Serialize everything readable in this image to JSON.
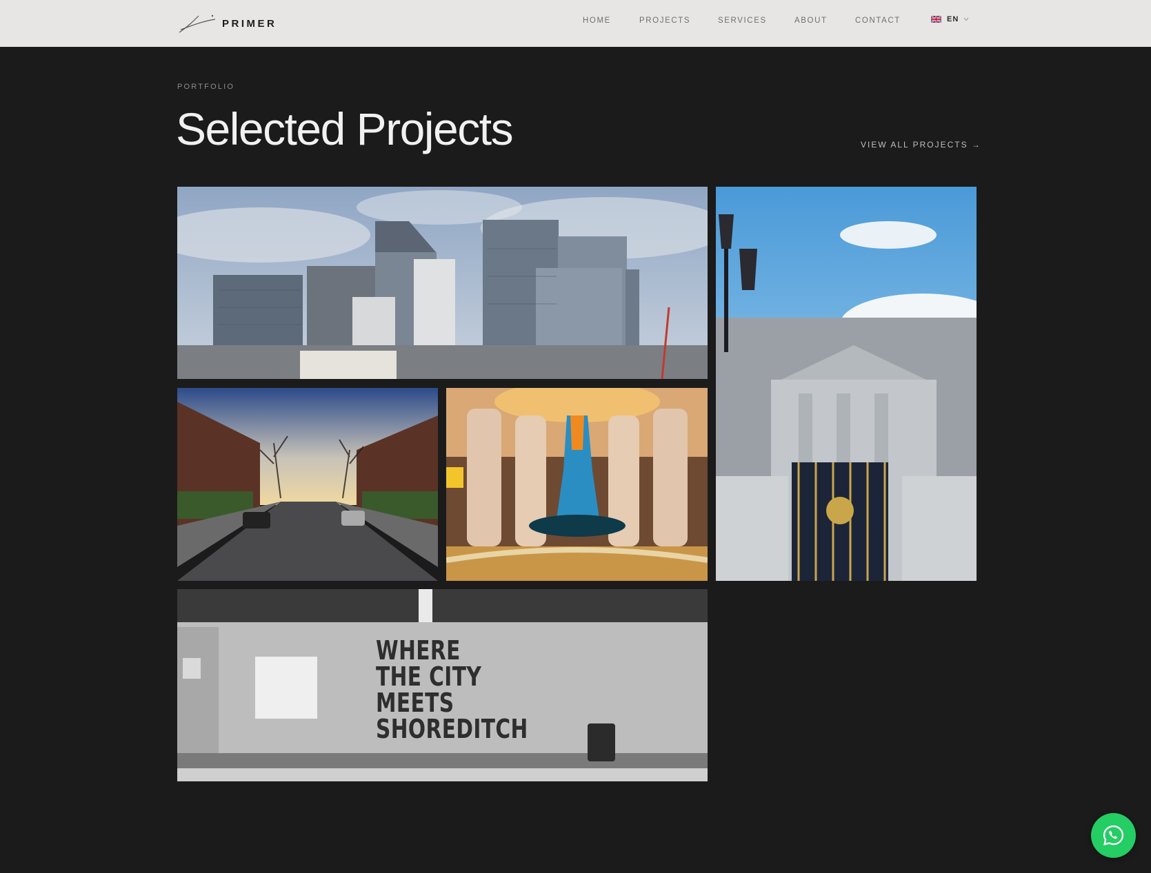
{
  "header": {
    "brand": "PRIMER",
    "nav": [
      {
        "label": "HOME"
      },
      {
        "label": "PROJECTS"
      },
      {
        "label": "SERVICES"
      },
      {
        "label": "ABOUT"
      },
      {
        "label": "CONTACT"
      }
    ],
    "language": "EN"
  },
  "section": {
    "eyebrow": "PORTFOLIO",
    "title": "Selected Projects",
    "view_all": "VIEW ALL PROJECTS →"
  },
  "projects": [
    {
      "image": "canary-wharf-skyline"
    },
    {
      "image": "buckingham-palace-gates"
    },
    {
      "image": "tree-lined-street-at-sunset"
    },
    {
      "image": "atlantis-hotel-lobby-chandelier"
    },
    {
      "image": "shoreditch-hoarding",
      "sign_lines": [
        "WHERE",
        "THE CITY",
        "MEETS",
        "SHOREDITCH"
      ]
    }
  ],
  "colors": {
    "background": "#1b1b1b",
    "header": "#e7e6e4",
    "whatsapp": "#25cd65"
  },
  "whatsapp_icon": "whatsapp-icon"
}
